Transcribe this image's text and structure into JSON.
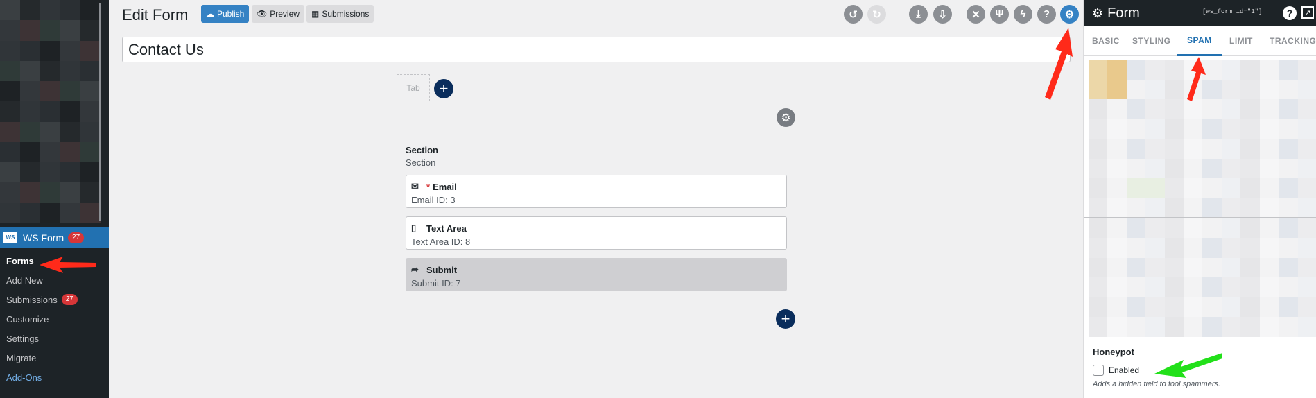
{
  "wp_menu": {
    "ws_form_label": "WS Form",
    "ws_form_badge": "27",
    "logo_text": "WS",
    "items": [
      {
        "label": "Forms",
        "badge": ""
      },
      {
        "label": "Add New",
        "badge": ""
      },
      {
        "label": "Submissions",
        "badge": "27"
      },
      {
        "label": "Customize",
        "badge": ""
      },
      {
        "label": "Settings",
        "badge": ""
      },
      {
        "label": "Migrate",
        "badge": ""
      },
      {
        "label": "Add-Ons",
        "badge": ""
      }
    ]
  },
  "editor": {
    "heading": "Edit Form",
    "publish_label": "Publish",
    "preview_label": "Preview",
    "submissions_label": "Submissions",
    "form_title": "Contact Us",
    "tab_label": "Tab",
    "section": {
      "title": "Section",
      "subtitle": "Section",
      "fields": [
        {
          "label": "Email",
          "meta": "Email  ID: 3",
          "required": true,
          "icon": "envelope-icon"
        },
        {
          "label": "Text Area",
          "meta": "Text Area  ID: 8",
          "required": false,
          "icon": "textarea-icon"
        },
        {
          "label": "Submit",
          "meta": "Submit  ID: 7",
          "required": false,
          "icon": "share-arrow-icon"
        }
      ]
    },
    "toolbar_icons": [
      "history-icon",
      "redo-icon",
      "download-icon",
      "upload-icon",
      "tools-icon",
      "branch-icon",
      "lightning-icon",
      "help-icon",
      "gear-icon"
    ]
  },
  "panel": {
    "title": "Form",
    "shortcode": "[ws_form id=\"1\"]",
    "tabs": [
      "BASIC",
      "STYLING",
      "SPAM",
      "LIMIT",
      "TRACKING"
    ],
    "active_tab": "SPAM",
    "honeypot": {
      "label": "Honeypot",
      "checkbox_label": "Enabled",
      "checked": false,
      "help": "Adds a hidden field to fool spammers."
    }
  },
  "colors": {
    "accent": "#2271b1",
    "required": "#d63638",
    "arrow_red": "#ff2a1a",
    "arrow_green": "#22e01a"
  }
}
